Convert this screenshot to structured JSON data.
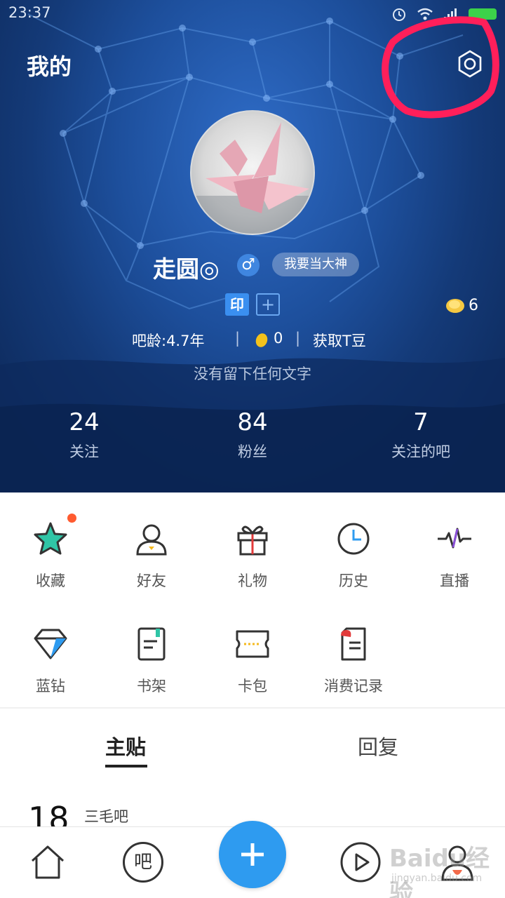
{
  "status_bar": {
    "time": "23:37"
  },
  "header": {
    "title": "我的"
  },
  "profile": {
    "username": "走圆◎",
    "gender_symbol": "♂",
    "god_badge": "我要当大神",
    "stamp_badge": "印",
    "add_badge": "+",
    "coins": "6",
    "age_label": "吧龄:4.7年",
    "separator": "|",
    "beans": "0",
    "get_beans": "获取T豆",
    "signature": "没有留下任何文字"
  },
  "stats": [
    {
      "value": "24",
      "label": "关注"
    },
    {
      "value": "84",
      "label": "粉丝"
    },
    {
      "value": "7",
      "label": "关注的吧"
    }
  ],
  "menu": [
    {
      "label": "收藏",
      "icon": "star-icon"
    },
    {
      "label": "好友",
      "icon": "friend-icon"
    },
    {
      "label": "礼物",
      "icon": "gift-icon"
    },
    {
      "label": "历史",
      "icon": "clock-icon"
    },
    {
      "label": "直播",
      "icon": "live-pulse-icon"
    },
    {
      "label": "蓝钻",
      "icon": "diamond-icon"
    },
    {
      "label": "书架",
      "icon": "bookshelf-icon"
    },
    {
      "label": "卡包",
      "icon": "card-icon"
    },
    {
      "label": "消费记录",
      "icon": "receipt-icon"
    }
  ],
  "tabs": {
    "main": "主贴",
    "reply": "回复"
  },
  "post": {
    "day": "18",
    "forum": "三毛吧"
  },
  "bottom_nav": {
    "ba_label": "吧",
    "plus": "+"
  },
  "watermark": {
    "text": "Baidu经验",
    "sub": "jingyan.baidu.com"
  },
  "colors": {
    "accent": "#2e9bf0",
    "annotation": "#ff1f5a",
    "hero": "#1d4f9c"
  }
}
